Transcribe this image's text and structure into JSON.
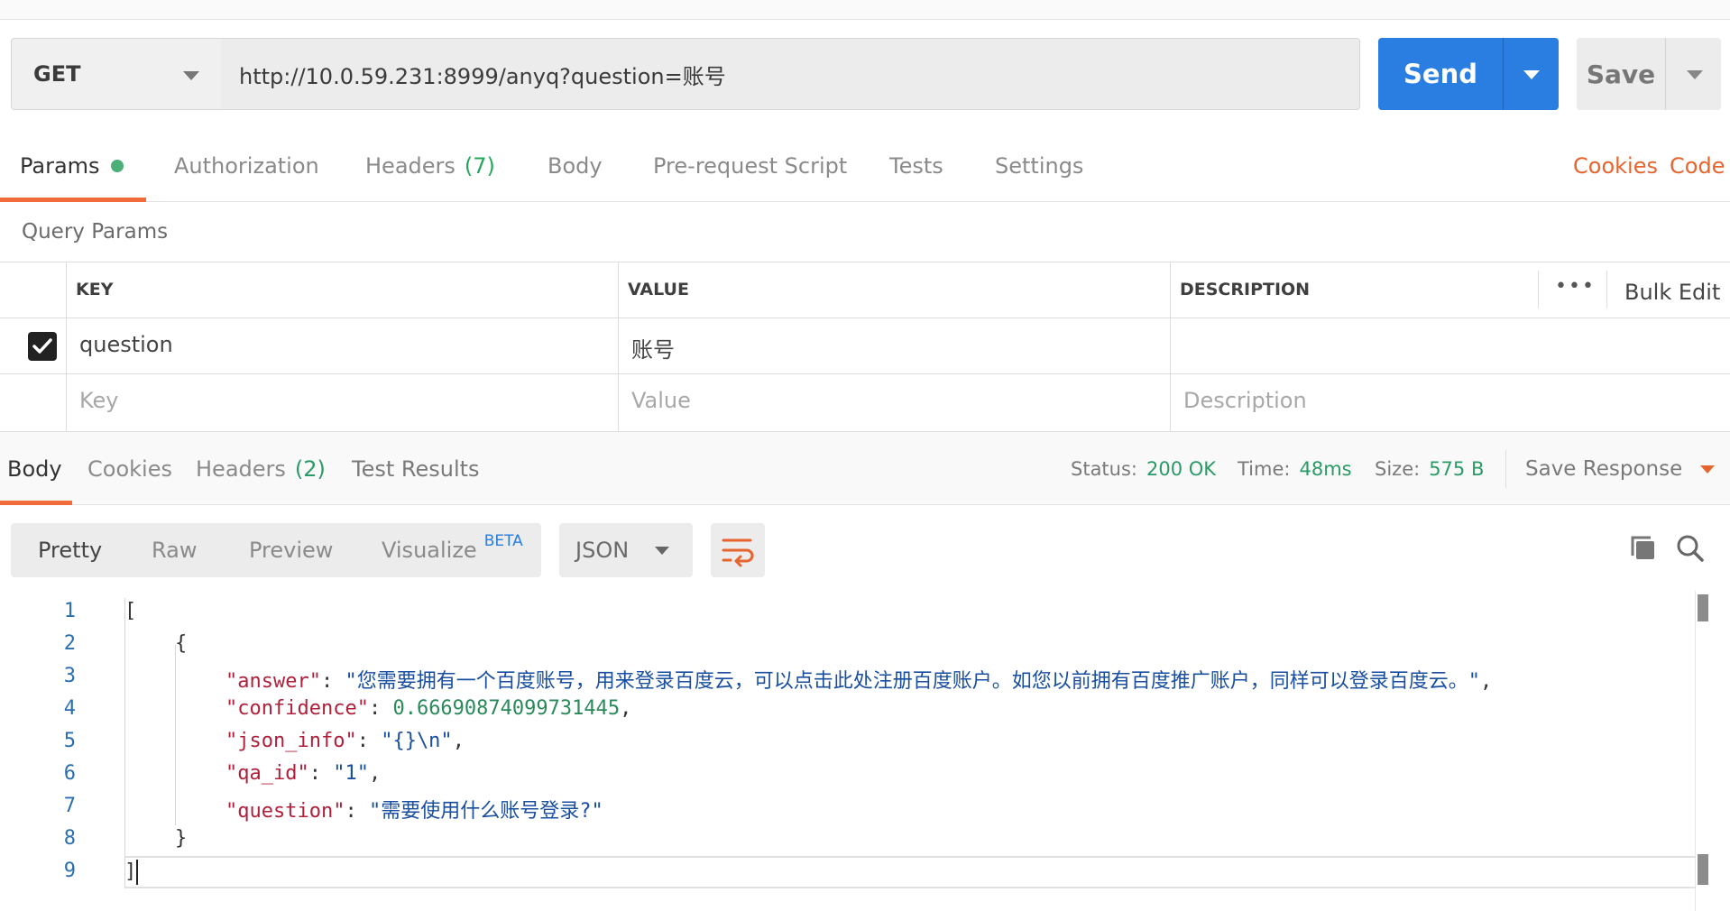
{
  "request": {
    "method": "GET",
    "url": "http://10.0.59.231:8999/anyq?question=账号",
    "send_label": "Send",
    "save_label": "Save"
  },
  "request_tabs": [
    {
      "label": "Params",
      "active": true,
      "dot": true
    },
    {
      "label": "Authorization"
    },
    {
      "label": "Headers",
      "count": "(7)"
    },
    {
      "label": "Body"
    },
    {
      "label": "Pre-request Script"
    },
    {
      "label": "Tests"
    },
    {
      "label": "Settings"
    }
  ],
  "links": {
    "cookies": "Cookies",
    "code": "Code"
  },
  "query_params": {
    "title": "Query Params",
    "columns": [
      "KEY",
      "VALUE",
      "DESCRIPTION"
    ],
    "bulk_edit": "Bulk Edit",
    "more": "•••",
    "rows": [
      {
        "checked": true,
        "key": "question",
        "value": "账号",
        "description": ""
      }
    ],
    "placeholders": {
      "key": "Key",
      "value": "Value",
      "description": "Description"
    }
  },
  "response_tabs": [
    {
      "label": "Body",
      "active": true
    },
    {
      "label": "Cookies"
    },
    {
      "label": "Headers",
      "count": "(2)"
    },
    {
      "label": "Test Results"
    }
  ],
  "response_meta": {
    "status_label": "Status:",
    "status": "200 OK",
    "time_label": "Time:",
    "time": "48ms",
    "size_label": "Size:",
    "size": "575 B",
    "save_response": "Save Response"
  },
  "view_modes": {
    "pretty": "Pretty",
    "raw": "Raw",
    "preview": "Preview",
    "visualize": "Visualize",
    "beta": "BETA",
    "format": "JSON"
  },
  "body": {
    "line_numbers": [
      "1",
      "2",
      "3",
      "4",
      "5",
      "6",
      "7",
      "8",
      "9"
    ],
    "open_bracket": "[",
    "open_brace": "{",
    "close_brace": "}",
    "close_bracket": "]",
    "fields": {
      "answer_key": "\"answer\"",
      "answer_val": "\"您需要拥有一个百度账号，用来登录百度云，可以点击此处注册百度账户。如您以前拥有百度推广账户，同样可以登录百度云。\"",
      "confidence_key": "\"confidence\"",
      "confidence_val": "0.66690874099731445",
      "json_info_key": "\"json_info\"",
      "json_info_val": "\"{}\\n\"",
      "qa_id_key": "\"qa_id\"",
      "qa_id_val": "\"1\"",
      "question_key": "\"question\"",
      "question_val": "\"需要使用什么账号登录?\""
    }
  },
  "colors": {
    "accent": "#f26b3a",
    "send": "#2a7de1",
    "status_green": "#2b9a66",
    "json_key": "#b0203b",
    "json_string": "#1a4fa0",
    "json_number": "#2a8a59"
  }
}
